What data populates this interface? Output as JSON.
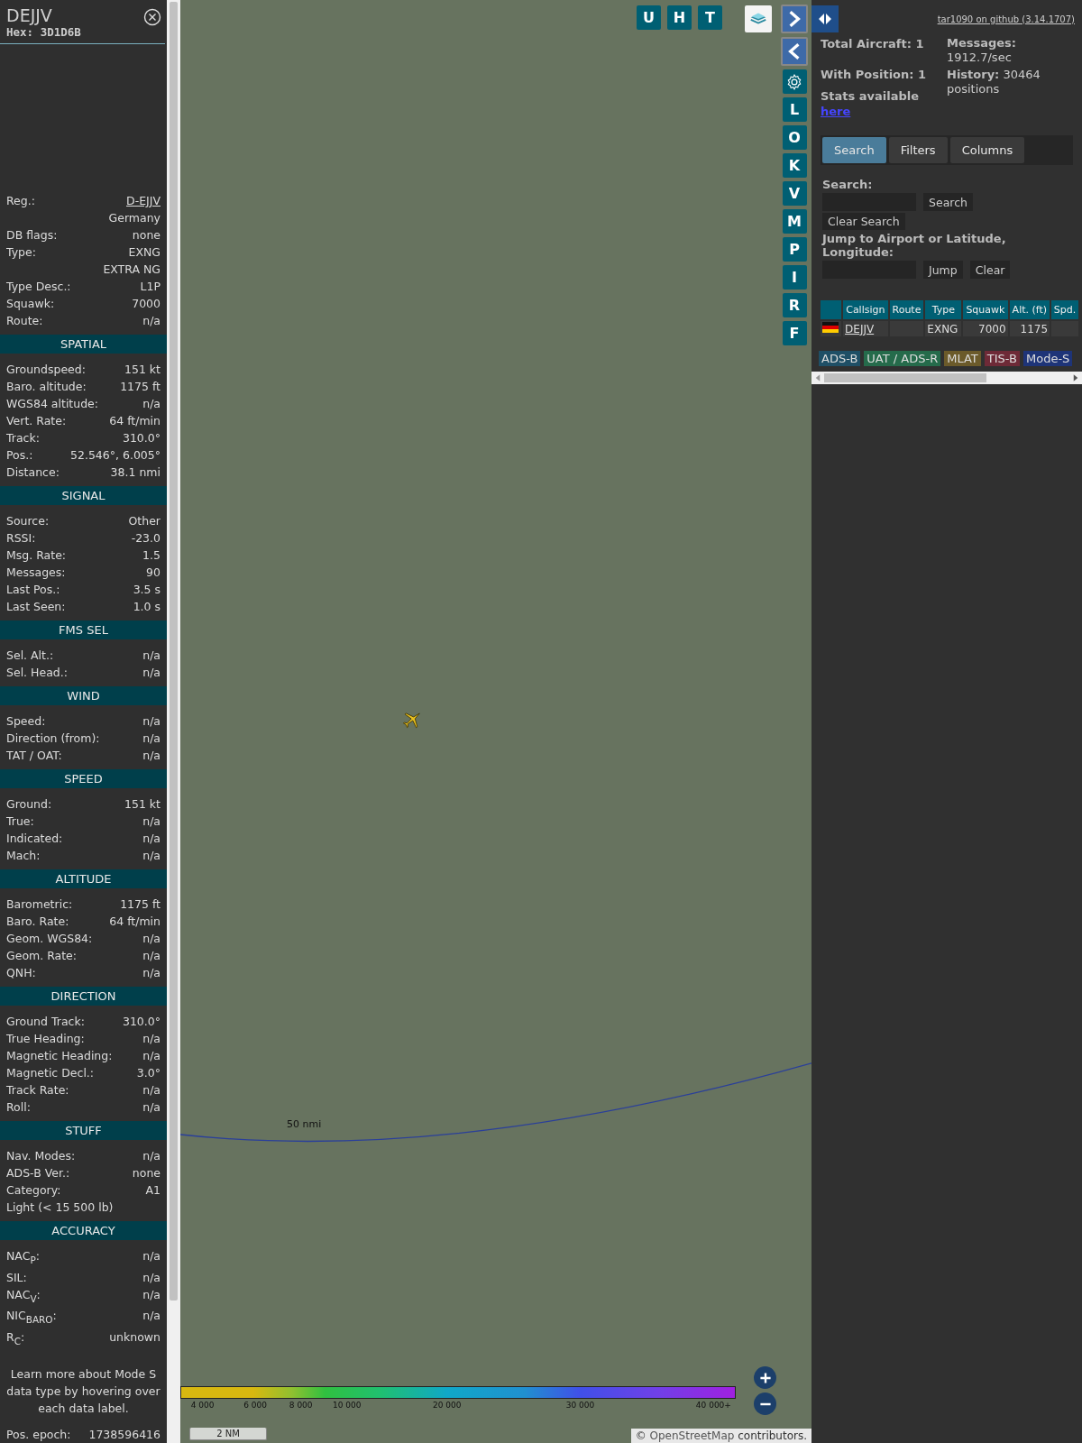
{
  "details": {
    "callsign": "DEJJV",
    "hex": "Hex: 3D1D6B",
    "sections": [
      {
        "rows": [
          {
            "label": "Reg.:",
            "value": "D-EJJV",
            "kind": "link"
          },
          {
            "value": "Germany"
          },
          {
            "label": "DB flags:",
            "value": "none"
          },
          {
            "label": "Type:",
            "value": "EXNG"
          },
          {
            "value": "EXTRA NG"
          },
          {
            "label": "Type Desc.:",
            "value": "L1P"
          },
          {
            "label": "Squawk:",
            "value": "7000"
          },
          {
            "label": "Route:",
            "value": "n/a"
          }
        ]
      },
      {
        "title": "SPATIAL",
        "rows": [
          {
            "label": "Groundspeed:",
            "value": "151 kt"
          },
          {
            "label": "Baro. altitude:",
            "value": "1175 ft"
          },
          {
            "label": "WGS84 altitude:",
            "value": "n/a"
          },
          {
            "label": "Vert. Rate:",
            "value": "64 ft/min"
          },
          {
            "label": "Track:",
            "value": "310.0°"
          },
          {
            "label": "Pos.:",
            "value": "52.546°, 6.005°"
          },
          {
            "label": "Distance:",
            "value": "38.1 nmi"
          }
        ]
      },
      {
        "title": "SIGNAL",
        "rows": [
          {
            "label": "Source:",
            "value": "Other"
          },
          {
            "label": "RSSI:",
            "value": "-23.0"
          },
          {
            "label": "Msg. Rate:",
            "value": "1.5"
          },
          {
            "label": "Messages:",
            "value": "90"
          },
          {
            "label": "Last Pos.:",
            "value": "3.5 s"
          },
          {
            "label": "Last Seen:",
            "value": "1.0 s"
          }
        ]
      },
      {
        "title": "FMS SEL",
        "rows": [
          {
            "label": "Sel. Alt.:",
            "value": "n/a"
          },
          {
            "label": "Sel. Head.:",
            "value": "n/a"
          }
        ]
      },
      {
        "title": "WIND",
        "rows": [
          {
            "label": "Speed:",
            "value": "n/a"
          },
          {
            "label": "Direction (from):",
            "value": "n/a"
          },
          {
            "label": "TAT / OAT:",
            "value": "n/a"
          }
        ]
      },
      {
        "title": "SPEED",
        "rows": [
          {
            "label": "Ground:",
            "value": "151 kt"
          },
          {
            "label": "True:",
            "value": "n/a"
          },
          {
            "label": "Indicated:",
            "value": "n/a"
          },
          {
            "label": "Mach:",
            "value": "n/a"
          }
        ]
      },
      {
        "title": "ALTITUDE",
        "rows": [
          {
            "label": "Barometric:",
            "value": "1175 ft"
          },
          {
            "label": "Baro. Rate:",
            "value": "64 ft/min"
          },
          {
            "label": "Geom. WGS84:",
            "value": "n/a"
          },
          {
            "label": "Geom. Rate:",
            "value": "n/a"
          },
          {
            "label": "QNH:",
            "value": "n/a"
          }
        ]
      },
      {
        "title": "DIRECTION",
        "rows": [
          {
            "label": "Ground Track:",
            "value": "310.0°"
          },
          {
            "label": "True Heading:",
            "value": "n/a"
          },
          {
            "label": "Magnetic Heading:",
            "value": "n/a"
          },
          {
            "label": "Magnetic Decl.:",
            "value": "3.0°"
          },
          {
            "label": "Track Rate:",
            "value": "n/a"
          },
          {
            "label": "Roll:",
            "value": "n/a"
          }
        ]
      },
      {
        "title": "STUFF",
        "rows": [
          {
            "label": "Nav. Modes:",
            "value": "n/a"
          },
          {
            "label": "ADS-B Ver.:",
            "value": "none"
          },
          {
            "label": "Category:",
            "value": "A1"
          },
          {
            "label": "Light (< 15 500 lb)"
          }
        ]
      },
      {
        "title": "ACCURACY",
        "rows": [
          {
            "label": "NAC$_{P}$:",
            "value": "n/a"
          },
          {
            "label": "SIL:",
            "value": "n/a"
          },
          {
            "label": "NAC$_{V}$:",
            "value": "n/a"
          },
          {
            "label": "NIC$_{BARO}$:",
            "value": "n/a"
          },
          {
            "label": "R$_{C}$:",
            "value": "unknown"
          }
        ]
      }
    ],
    "note": "Learn more about Mode S data type by hovering over each data label.",
    "epoch": {
      "label": "Pos. epoch:",
      "value": "1738596416"
    }
  },
  "map": {
    "top_buttons": [
      "U",
      "H",
      "T"
    ],
    "side_buttons": [
      {
        "kind": "next"
      },
      {
        "kind": "prev"
      },
      {
        "kind": "settings"
      },
      {
        "kind": "letter",
        "label": "L"
      },
      {
        "kind": "letter",
        "label": "O"
      },
      {
        "kind": "letter",
        "label": "K"
      },
      {
        "kind": "letter",
        "label": "V"
      },
      {
        "kind": "letter",
        "label": "M"
      },
      {
        "kind": "letter",
        "label": "P"
      },
      {
        "kind": "letter",
        "label": "I"
      },
      {
        "kind": "letter",
        "label": "R"
      },
      {
        "kind": "letter",
        "label": "F"
      }
    ],
    "range_label": "50 nmi",
    "altitude_ticks": [
      "4 000",
      "6 000",
      "8 000",
      "10 000",
      "20 000",
      "30 000",
      "40 000+"
    ],
    "scale": "2 NM",
    "attribution": {
      "prefix": "©",
      "link": "OpenStreetMap",
      "suffix": "contributors."
    }
  },
  "panel": {
    "github_link": "tar1090 on github (3.14.1707)",
    "stats": {
      "total": "Total Aircraft: 1",
      "with_position": "With Position: 1",
      "stats_text": "Stats available",
      "stats_link": "here",
      "messages": {
        "label": "Messages:",
        "value": "1912.7/sec"
      },
      "history": {
        "label": "History:",
        "value": "30464 positions"
      }
    },
    "tabs": [
      {
        "label": "Search",
        "selected": true
      },
      {
        "label": "Filters",
        "selected": false
      },
      {
        "label": "Columns",
        "selected": false
      }
    ],
    "search": {
      "label": "Search:",
      "button": "Search",
      "clear": "Clear Search",
      "jump_label": "Jump to Airport or Latitude, Longitude:",
      "jump": "Jump",
      "jump_clear": "Clear"
    },
    "table": {
      "columns": [
        "Callsign",
        "Route",
        "Type",
        "Squawk",
        "Alt. (ft)",
        "Spd."
      ],
      "rows": [
        {
          "cells": [
            "DEJJV",
            null,
            "EXNG",
            "7000",
            "1175",
            null
          ]
        }
      ]
    },
    "sources": [
      {
        "label": "ADS-B",
        "color": "#1f4f66"
      },
      {
        "label": "UAT / ADS-R",
        "color": "#256b4b"
      },
      {
        "label": "MLAT",
        "color": "#6b5a2a"
      },
      {
        "label": "TIS-B",
        "color": "#6e2a37"
      },
      {
        "label": "Mode-S",
        "color": "#1e3478"
      }
    ]
  }
}
